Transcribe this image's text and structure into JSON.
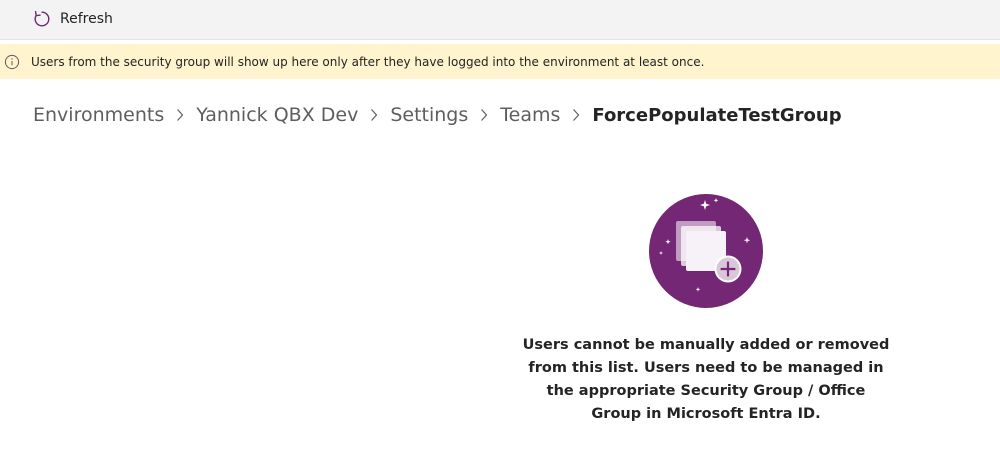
{
  "toolbar": {
    "refresh_label": "Refresh",
    "refresh_icon": "refresh-icon"
  },
  "info_bar": {
    "icon": "info-icon",
    "message": "Users from the security group will show up here only after they have logged into the environment at least once."
  },
  "breadcrumb": {
    "items": [
      "Environments",
      "Yannick QBX Dev",
      "Settings",
      "Teams"
    ],
    "current": "ForcePopulateTestGroup",
    "separator_icon": "chevron-right-icon"
  },
  "empty_state": {
    "illustration": "add-users-illustration",
    "message": "Users cannot be manually added or removed from this list. Users need to be managed in the appropriate Security Group / Office Group in Microsoft Entra ID."
  },
  "colors": {
    "accent": "#742774",
    "info_background": "#fff4ce",
    "toolbar_background": "#f3f3f3"
  }
}
